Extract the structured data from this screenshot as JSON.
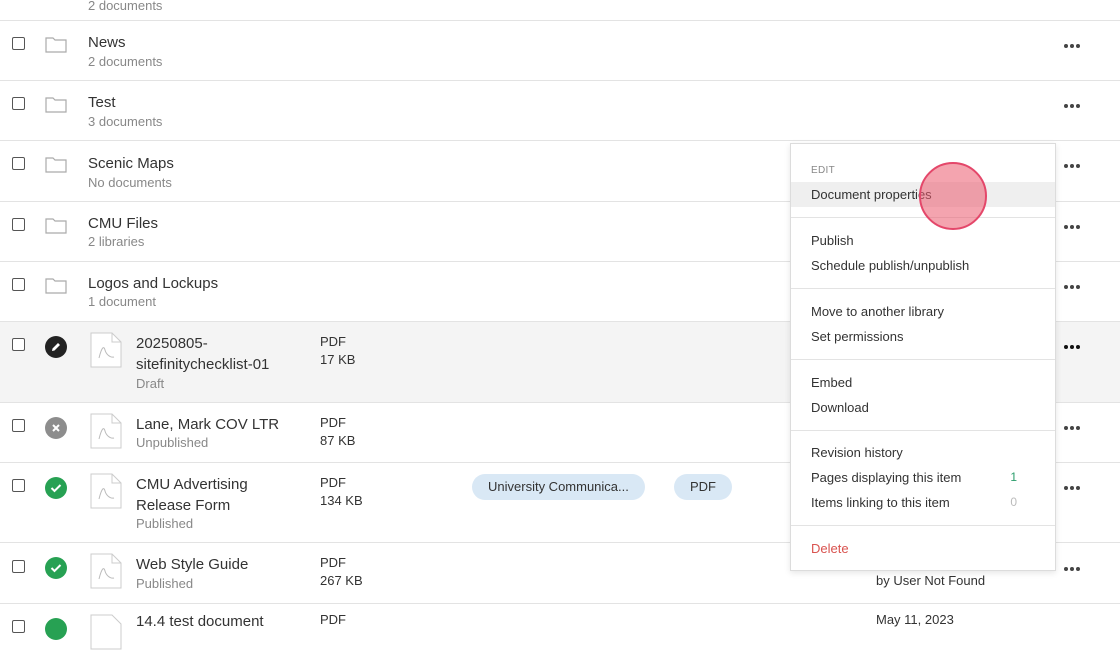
{
  "rows": [
    {
      "title": "",
      "sub": "2 documents"
    },
    {
      "title": "News",
      "sub": "2 documents"
    },
    {
      "title": "Test",
      "sub": "3 documents"
    },
    {
      "title": "Scenic Maps",
      "sub": "No documents"
    },
    {
      "title": "CMU Files",
      "sub": "2 libraries"
    },
    {
      "title": "Logos and Lockups",
      "sub": "1 document"
    }
  ],
  "docs": [
    {
      "title1": "20250805-",
      "title2": "sitefinitychecklist-01",
      "status": "Draft",
      "type": "PDF",
      "size": "17 KB"
    },
    {
      "title1": "Lane, Mark COV LTR",
      "status": "Unpublished",
      "type": "PDF",
      "size": "87 KB"
    },
    {
      "title1": "CMU Advertising",
      "title2": "Release Form",
      "status": "Published",
      "type": "PDF",
      "size": "134 KB",
      "tags": [
        "University Communica...",
        "PDF"
      ]
    },
    {
      "title1": "Web Style Guide",
      "status": "Published",
      "type": "PDF",
      "size": "267 KB",
      "author": "by User Not Found"
    },
    {
      "title1": "14.4 test document",
      "type": "PDF",
      "date": "May 11, 2023"
    }
  ],
  "menu": {
    "header": "EDIT",
    "document_properties": "Document properties",
    "publish": "Publish",
    "schedule": "Schedule publish/unpublish",
    "move": "Move to another library",
    "permissions": "Set permissions",
    "embed": "Embed",
    "download": "Download",
    "revision_history": "Revision history",
    "pages_displaying": "Pages displaying this item",
    "pages_displaying_count": "1",
    "items_linking": "Items linking to this item",
    "items_linking_count": "0",
    "delete": "Delete"
  },
  "colors": {
    "published": "#27a153",
    "unpublished": "#8d8d8d",
    "draft": "#222222",
    "delete": "#d9534f",
    "tag_bg": "#d9e8f5"
  },
  "icons": {
    "folder": "folder-icon",
    "file": "pdf-file-icon",
    "more": "more-options-icon",
    "draft": "pencil-icon",
    "unpublished": "x-icon",
    "published": "check-icon"
  }
}
